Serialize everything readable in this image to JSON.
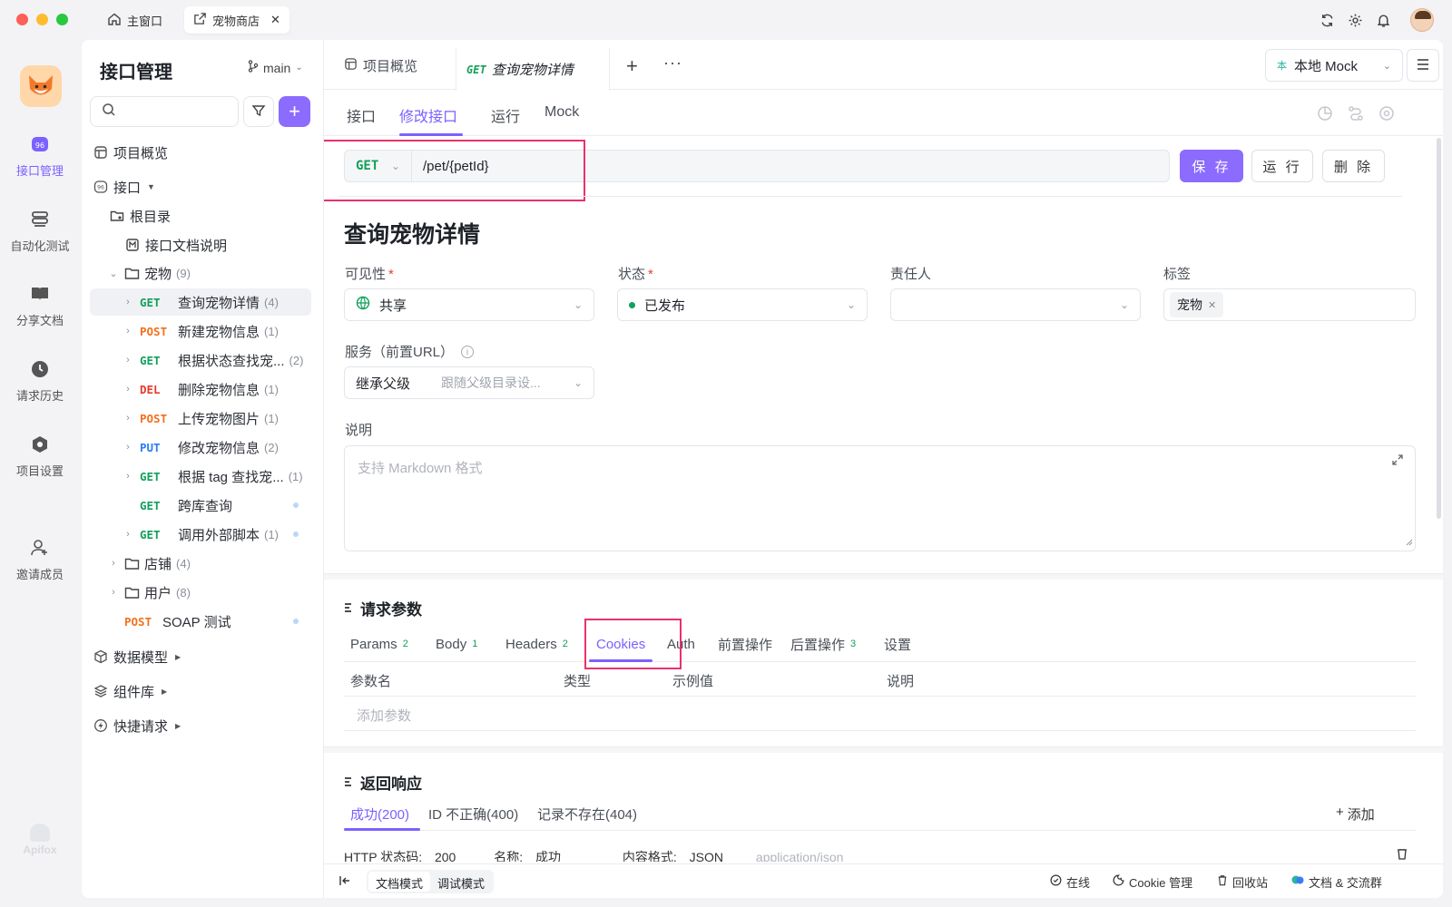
{
  "titlebar": {
    "home_tab": "主窗口",
    "shop_tab": "宠物商店"
  },
  "rail": {
    "items": [
      {
        "label": "接口管理"
      },
      {
        "label": "自动化测试"
      },
      {
        "label": "分享文档"
      },
      {
        "label": "请求历史"
      },
      {
        "label": "项目设置"
      },
      {
        "label": "邀请成员"
      }
    ],
    "footer_logo": "Apifox"
  },
  "sidebar": {
    "title": "接口管理",
    "branch": "main",
    "items": [
      {
        "label": "项目概览"
      },
      {
        "label": "接口"
      },
      {
        "label": "根目录"
      },
      {
        "label": "接口文档说明"
      },
      {
        "label": "宠物",
        "count": "(9)"
      },
      {
        "method": "GET",
        "label": "查询宠物详情",
        "count": "(4)"
      },
      {
        "method": "POST",
        "label": "新建宠物信息",
        "count": "(1)"
      },
      {
        "method": "GET",
        "label": "根据状态查找宠...",
        "count": "(2)"
      },
      {
        "method": "DEL",
        "label": "删除宠物信息",
        "count": "(1)"
      },
      {
        "method": "POST",
        "label": "上传宠物图片",
        "count": "(1)"
      },
      {
        "method": "PUT",
        "label": "修改宠物信息",
        "count": "(2)"
      },
      {
        "method": "GET",
        "label": "根据 tag 查找宠...",
        "count": "(1)"
      },
      {
        "method": "GET",
        "label": "跨库查询"
      },
      {
        "method": "GET",
        "label": "调用外部脚本",
        "count": "(1)"
      },
      {
        "label": "店铺",
        "count": "(4)"
      },
      {
        "label": "用户",
        "count": "(8)"
      },
      {
        "method": "POST",
        "label": "SOAP 测试"
      },
      {
        "label": "数据模型"
      },
      {
        "label": "组件库"
      },
      {
        "label": "快捷请求"
      }
    ]
  },
  "main": {
    "tabs": {
      "overview": "项目概览",
      "current_method": "GET",
      "current_title": "查询宠物详情"
    },
    "env": "本地 Mock",
    "env_badge": "本",
    "subtabs": [
      "接口",
      "修改接口",
      "运行",
      "Mock"
    ],
    "method": "GET",
    "url": "/pet/{petId}",
    "buttons": {
      "save": "保 存",
      "run": "运 行",
      "delete": "删 除"
    },
    "api_title": "查询宠物详情",
    "fields": {
      "visibility_label": "可见性",
      "visibility_value": "共享",
      "status_label": "状态",
      "status_value": "已发布",
      "owner_label": "责任人",
      "tags_label": "标签",
      "tag_value": "宠物",
      "service_label": "服务（前置URL）",
      "service_value": "继承父级",
      "service_hint": "跟随父级目录设...",
      "desc_label": "说明",
      "desc_placeholder": "支持 Markdown 格式"
    },
    "request": {
      "section_title": "请求参数",
      "tabs": [
        {
          "label": "Params",
          "count": "2"
        },
        {
          "label": "Body",
          "count": "1"
        },
        {
          "label": "Headers",
          "count": "2"
        },
        {
          "label": "Cookies"
        },
        {
          "label": "Auth"
        },
        {
          "label": "前置操作"
        },
        {
          "label": "后置操作",
          "count": "3"
        },
        {
          "label": "设置"
        }
      ],
      "columns": [
        "参数名",
        "类型",
        "示例值",
        "说明"
      ],
      "add_param": "添加参数"
    },
    "response": {
      "section_title": "返回响应",
      "tabs": [
        "成功(200)",
        "ID 不正确(400)",
        "记录不存在(404)"
      ],
      "add": "添加",
      "row": {
        "status_label": "HTTP 状态码:",
        "status_value": "200",
        "name_label": "名称:",
        "name_value": "成功",
        "format_label": "内容格式:",
        "format_value": "JSON",
        "mime": "application/json"
      }
    },
    "bottom": {
      "doc_mode": "文档模式",
      "debug_mode": "调试模式",
      "online": "在线",
      "cookie": "Cookie 管理",
      "trash": "回收站",
      "docs": "文档 & 交流群"
    }
  },
  "colors": {
    "accent": "#7b61ff",
    "get": "#12a05a",
    "post": "#f3701d",
    "del": "#e63c2f",
    "put": "#2d7cf6",
    "highlight": "#e8326a"
  }
}
